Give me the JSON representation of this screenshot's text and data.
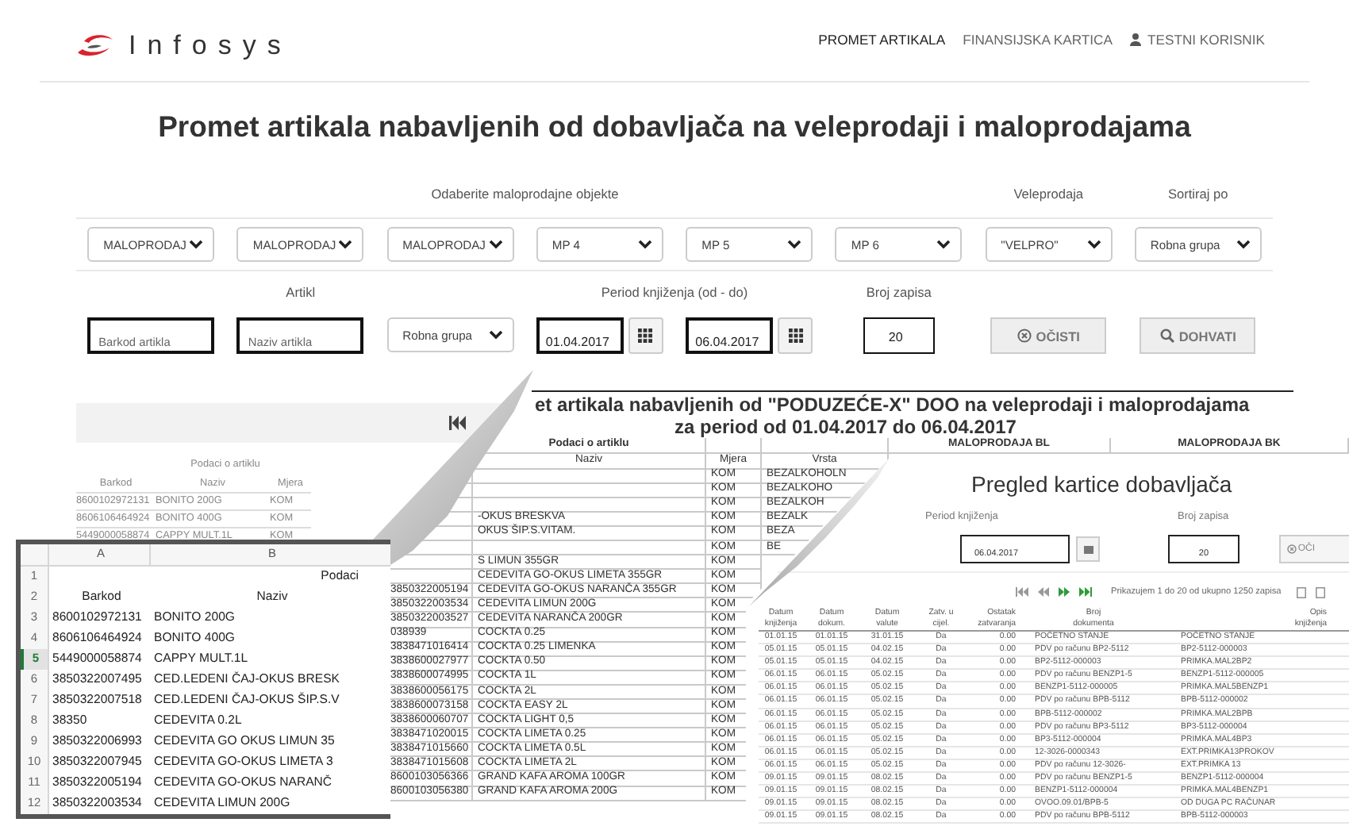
{
  "header": {
    "logo": "Infosys",
    "nav": [
      {
        "label": "PROMET ARTIKALA",
        "selected": true,
        "kind": "link"
      },
      {
        "label": "FINANSIJSKA KARTICA",
        "selected": false,
        "kind": "link"
      },
      {
        "label": "TESTNI KORISNIK",
        "selected": false,
        "kind": "user"
      }
    ]
  },
  "title": "Promet artikala nabavljenih od dobavljača na veleprodaji i maloprodajama",
  "filters": {
    "retail_label": "Odaberite maloprodajne objekte",
    "retail_selects": [
      "MALOPRODAJ",
      "MALOPRODAJ",
      "MALOPRODAJ",
      "MP 4",
      "MP 5",
      "MP 6"
    ],
    "wholesale_label": "Veleprodaja",
    "wholesale_select": "\"VELPRO\"",
    "sort_label": "Sortiraj po",
    "sort_select": "Robna grupa"
  },
  "search": {
    "article_label": "Artikl",
    "barcode_placeholder": "Barkod artikla",
    "name_placeholder": "Naziv artikla",
    "group_select": "Robna grupa",
    "period_label": "Period knjiženja (od - do)",
    "date_from": "01.04.2017",
    "date_to": "06.04.2017",
    "count_label": "Broj zapisa",
    "count": "20",
    "buttons": [
      {
        "label": "OČISTI",
        "kind": "clear"
      },
      {
        "label": "DOHVATI",
        "kind": "search"
      }
    ]
  },
  "page_table": {
    "group": "Podaci o artiklu",
    "columns": [
      "Barkod",
      "Naziv",
      "Mjera"
    ],
    "rows": [
      [
        "8600102972131",
        "BONITO 200G",
        "KOM"
      ],
      [
        "8606106464924",
        "BONITO 400G",
        "KOM"
      ],
      [
        "5449000058874",
        "CAPPY MULT.1L",
        "KOM"
      ]
    ]
  },
  "report": {
    "title": "et artikala nabavljenih od \"PODUZEĆE-X\" DOO na veleprodaji i maloprodajama",
    "subtitle": "za period od 01.04.2017 do 06.04.2017",
    "group_headers": [
      "Podaci o artiklu",
      "MALOPRODAJA BL",
      "MALOPRODAJA BK"
    ],
    "columns": [
      "Naziv",
      "Mjera",
      "Vrsta"
    ],
    "rows": [
      {
        "unit": "KOM",
        "type": "BEZALKOHOLN"
      },
      {
        "unit": "KOM",
        "type": "BEZALKOHO"
      },
      {
        "unit": "KOM",
        "type": "BEZALKOH"
      },
      {
        "name": "-OKUS BRESKVA",
        "unit": "KOM",
        "type": "BEZALK"
      },
      {
        "name": "OKUS ŠIP.S.VITAM.",
        "unit": "KOM",
        "type": "BEZA"
      },
      {
        "unit": "KOM",
        "type": "BE"
      },
      {
        "name": "S LIMUN 355GR",
        "unit": "KOM"
      },
      {
        "name": "CEDEVITA GO-OKUS LIMETA 355GR",
        "unit": "KOM"
      },
      {
        "barcode": "3850322005194",
        "name": "CEDEVITA GO-OKUS NARANČA 355GR",
        "unit": "KOM"
      },
      {
        "barcode": "3850322003534",
        "name": "CEDEVITA LIMUN 200G",
        "unit": "KOM"
      },
      {
        "barcode": "3850322003527",
        "name": "CEDEVITA NARANČA 200GR",
        "unit": "KOM"
      },
      {
        "barcode": "038939",
        "name": "COCKTA 0.25",
        "unit": "KOM"
      },
      {
        "barcode": "3838471016414",
        "name": "COCKTA 0.25 LIMENKA",
        "unit": "KOM"
      },
      {
        "barcode": "3838600027977",
        "name": "COCKTA 0.50",
        "unit": "KOM"
      },
      {
        "barcode": "3838600074995",
        "name": "COCKTA 1L",
        "unit": "KOM"
      },
      {
        "barcode": "3838600056175",
        "name": "COCKTA 2L",
        "unit": "KOM"
      },
      {
        "barcode": "3838600073158",
        "name": "COCKTA EASY 2L",
        "unit": "KOM"
      },
      {
        "barcode": "3838600060707",
        "name": "COCKTA LIGHT 0,5",
        "unit": "KOM"
      },
      {
        "barcode": "3838471020015",
        "name": "COCKTA LIMETA 0.25",
        "unit": "KOM"
      },
      {
        "barcode": "3838471015660",
        "name": "COCKTA LIMETA 0.5L",
        "unit": "KOM"
      },
      {
        "barcode": "3838471015608",
        "name": "COCKTA LIMETA 2L",
        "unit": "KOM"
      },
      {
        "barcode": "8600103056366",
        "name": "GRAND KAFA AROMA 100GR",
        "unit": "KOM"
      },
      {
        "barcode": "8600103056380",
        "name": "GRAND KAFA AROMA 200G",
        "unit": "KOM"
      }
    ]
  },
  "spreadsheet": {
    "columns": [
      "A",
      "B"
    ],
    "rows": [
      {
        "number": "1",
        "kind": "title",
        "b": "Podaci",
        "selected": false
      },
      {
        "number": "2",
        "kind": "header",
        "a": "Barkod",
        "b": "Naziv",
        "selected": false
      },
      {
        "number": "3",
        "kind": "data",
        "a": "8600102972131",
        "b": "BONITO 200G",
        "selected": false
      },
      {
        "number": "4",
        "kind": "data",
        "a": "8606106464924",
        "b": "BONITO 400G",
        "selected": false
      },
      {
        "number": "5",
        "kind": "data",
        "a": "5449000058874",
        "b": "CAPPY MULT.1L",
        "selected": true
      },
      {
        "number": "6",
        "kind": "data",
        "a": "3850322007495",
        "b": "CED.LEDENI ČAJ-OKUS BRESK",
        "selected": false
      },
      {
        "number": "7",
        "kind": "data",
        "a": "3850322007518",
        "b": "CED.LEDENI ČAJ-OKUS ŠIP.S.V",
        "selected": false
      },
      {
        "number": "8",
        "kind": "data",
        "a": "38350",
        "b": "CEDEVITA 0.2L",
        "selected": false
      },
      {
        "number": "9",
        "kind": "data",
        "a": "3850322006993",
        "b": "CEDEVITA GO OKUS LIMUN 35",
        "selected": false
      },
      {
        "number": "10",
        "kind": "data",
        "a": "3850322007945",
        "b": "CEDEVITA GO-OKUS LIMETA 3",
        "selected": false
      },
      {
        "number": "11",
        "kind": "data",
        "a": "3850322005194",
        "b": "CEDEVITA GO-OKUS NARANČ",
        "selected": false
      },
      {
        "number": "12",
        "kind": "data",
        "a": "3850322003534",
        "b": "CEDEVITA LIMUN 200G",
        "selected": false
      }
    ]
  },
  "card": {
    "title": "Pregled kartice dobavljača",
    "period_label": "Period knjiženja",
    "date": "06.04.2017",
    "count_label": "Broj zapisa",
    "count": "20",
    "clear_button": "OČI",
    "paging": "Prikazujem 1 do 20 od ukupno 1250 zapisa",
    "header_rows": [
      [
        "Datum",
        "Datum",
        "Datum",
        "Zatv. u",
        "Ostatak",
        "Broj",
        "Opis"
      ],
      [
        "knjiženja",
        "dokum.",
        "valute",
        "cijel.",
        "zatvaranja",
        "dokumenta",
        "knjiženja"
      ]
    ],
    "rows": [
      [
        "01.01.15",
        "01.01.15",
        "31.01.15",
        "Da",
        "0.00",
        "POČETNO STANJE",
        "POČETNO STANJE"
      ],
      [
        "05.01.15",
        "05.01.15",
        "04.02.15",
        "Da",
        "0.00",
        "PDV po računu BP2-5112",
        "BP2-5112-000003"
      ],
      [
        "05.01.15",
        "05.01.15",
        "04.02.15",
        "Da",
        "0.00",
        "BP2-5112-000003",
        "PRIMKA.MAL2BP2"
      ],
      [
        "06.01.15",
        "06.01.15",
        "05.02.15",
        "Da",
        "0.00",
        "PDV po računu BENZP1-5",
        "BENZP1-5112-000005"
      ],
      [
        "06.01.15",
        "06.01.15",
        "05.02.15",
        "Da",
        "0.00",
        "BENZP1-5112-000005",
        "PRIMKA.MAL5BENZP1"
      ],
      [
        "06.01.15",
        "06.01.15",
        "05.02.15",
        "Da",
        "0.00",
        "PDV po računu BPB-5112",
        "BPB-5112-000002"
      ],
      [
        "06.01.15",
        "06.01.15",
        "05.02.15",
        "Da",
        "0.00",
        "BPB-5112-000002",
        "PRIMKA.MAL2BPB"
      ],
      [
        "06.01.15",
        "06.01.15",
        "05.02.15",
        "Da",
        "0.00",
        "PDV po računu BP3-5112",
        "BP3-5112-000004"
      ],
      [
        "06.01.15",
        "06.01.15",
        "05.02.15",
        "Da",
        "0.00",
        "BP3-5112-000004",
        "PRIMKA.MAL4BP3"
      ],
      [
        "06.01.15",
        "06.01.15",
        "05.02.15",
        "Da",
        "0.00",
        "12-3026-0000343",
        "EXT.PRIMKA13PROKOV"
      ],
      [
        "06.01.15",
        "06.01.15",
        "05.02.15",
        "Da",
        "0.00",
        "PDV po računu 12-3026-",
        "EXT.PRIMKA 13"
      ],
      [
        "09.01.15",
        "09.01.15",
        "08.02.15",
        "Da",
        "0.00",
        "PDV po računu BENZP1-5",
        "BENZP1-5112-000004"
      ],
      [
        "09.01.15",
        "09.01.15",
        "08.02.15",
        "Da",
        "0.00",
        "BENZP1-5112-000004",
        "PRIMKA.MAL4BENZP1"
      ],
      [
        "09.01.15",
        "09.01.15",
        "08.02.15",
        "Da",
        "0.00",
        "OVOO.09.01/BPB-5",
        "OD DUGA PC RAČUNAR"
      ],
      [
        "09.01.15",
        "09.01.15",
        "08.02.15",
        "Da",
        "0.00",
        "PDV po računu BPB-5112",
        "BPB-5112-000003"
      ]
    ]
  }
}
